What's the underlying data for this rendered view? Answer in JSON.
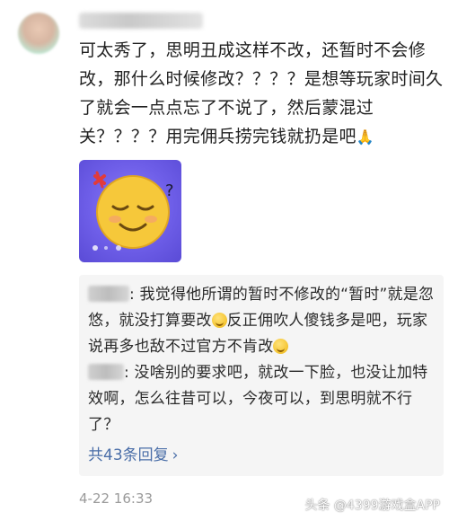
{
  "comment": {
    "text_main": "可太秀了，思明丑成这样不改，还暂时不会修改，那什么时候修改？？？？是想等玩家时间久了就会一点点忘了不说了，然后蒙混过关？？？？用完佣兵捞完钱就扔是吧",
    "pray_emoji": "🙏",
    "timestamp": "4-22 16:33"
  },
  "replies": [
    {
      "text_a": "我觉得他所谓的暂时不修改的“暂时”就是忽悠，就没打算要改",
      "text_b": "反正佣吹人傻钱多是吧，玩家说再多也敌不过官方不肯改"
    },
    {
      "text_a": "没啥别的要求吧，就改一下脸，也没让加特效啊，怎么往昔可以，今夜可以，到思明就不行了？"
    }
  ],
  "replies_footer": {
    "label": "共43条回复",
    "chevron": "›"
  },
  "watermark": "头条 @4399游戏盒APP",
  "colors": {
    "link": "#4a6ea8",
    "reply_bg": "#f5f5f5",
    "sticker_bg": "#6e5ee8"
  },
  "icons": {
    "sticker": "sleepy-smile-face",
    "smirk": "smirk-emoji",
    "pray": "pray-hands-emoji"
  }
}
